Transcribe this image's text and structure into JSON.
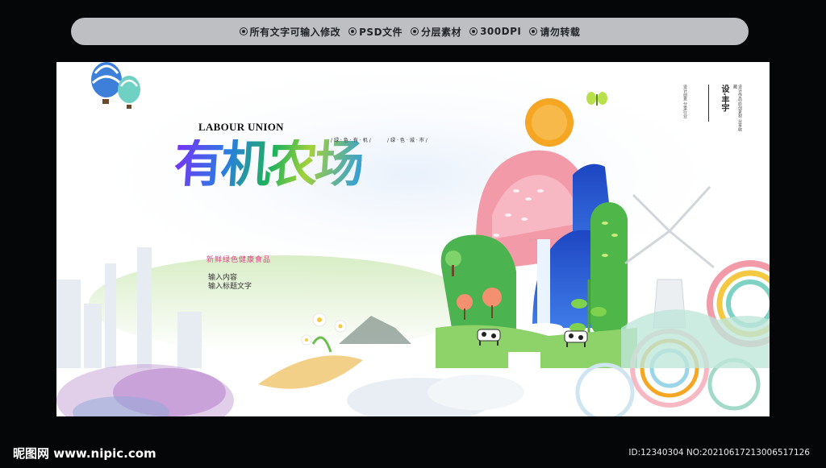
{
  "top_bar": {
    "items": [
      "所有文字可输入修改",
      "PSD文件",
      "分层素材",
      "300DPI",
      "请勿转载"
    ]
  },
  "poster": {
    "label_en": "LABOUR UNION",
    "title": "有机农场",
    "subtitle": "新鲜绿色健康食品",
    "input_lines": [
      "输入内容",
      "输入标题文字"
    ],
    "tags_left": "/绿·色·有·机/",
    "tags_right": "/绿·色·城·市/",
    "brand": "设·丰宇",
    "brand_mini_left": "设计创意 分享行业",
    "brand_mini_right": "设计作品 原创素材 分享收藏"
  },
  "footer": {
    "site_logo_text": "昵图网 www.nipic.com",
    "image_id": "ID:12340304 NO:20210617213006517126"
  },
  "colors": {
    "background": "#050608",
    "top_bar": "#bdbfc3",
    "poster_bg": "#ffffff",
    "sun": "#f5a623",
    "mountain_pink": "#f39aa9",
    "waterfall_blue": "#2b5fd6",
    "hill_green": "#4fb64a"
  }
}
